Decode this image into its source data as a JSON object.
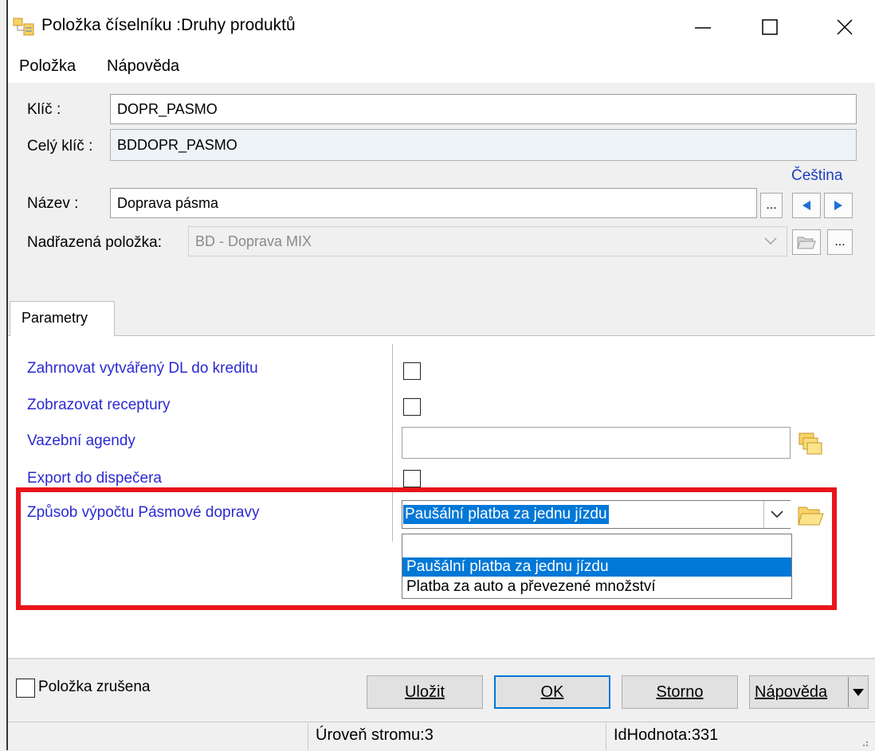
{
  "window": {
    "title": "Položka  číselníku :Druhy produktů",
    "minimize_label": "—",
    "maximize_label": "☐",
    "close_label": "✕"
  },
  "menu": [
    "Položka",
    "Nápověda"
  ],
  "form": {
    "key_label": "Klíč :",
    "key_value": "DOPR_PASMO",
    "full_key_label": "Celý klíč :",
    "full_key_value": "BDDOPR_PASMO",
    "language_link": "Čeština",
    "name_label": "Název :",
    "name_value": "Doprava pásma",
    "ellipsis": "...",
    "parent_label": "Nadřazená položka:",
    "parent_value": "BD - Doprava MIX"
  },
  "tabs": [
    "Parametry"
  ],
  "params": [
    {
      "label": "Zahrnovat vytvářený DL do kreditu",
      "type": "checkbox",
      "checked": false
    },
    {
      "label": "Zobrazovat receptury",
      "type": "checkbox",
      "checked": false
    },
    {
      "label": "Vazební agendy",
      "type": "text",
      "value": ""
    },
    {
      "label": "Export do dispečera",
      "type": "checkbox",
      "checked": false
    },
    {
      "label": "Způsob výpočtu Pásmové dopravy",
      "type": "select",
      "value": "Paušální platba za jednu jízdu"
    }
  ],
  "dropdown_options": [
    "",
    "Paušální platba za jednu jízdu",
    "Platba za auto a převezené množství"
  ],
  "footer": {
    "cancelled_label": "Položka zrušena",
    "save_label": "Uložit",
    "ok_label": "OK",
    "storno_label": "Storno",
    "help_label": "Nápověda"
  },
  "status": {
    "tree_level": "Úroveň stromu:3",
    "id_value": "IdHodnota:331"
  },
  "colors": {
    "accent": "#0078d7",
    "param_label": "#2a2ad0",
    "highlight": "#e8141c",
    "link": "#1a3fbf"
  }
}
